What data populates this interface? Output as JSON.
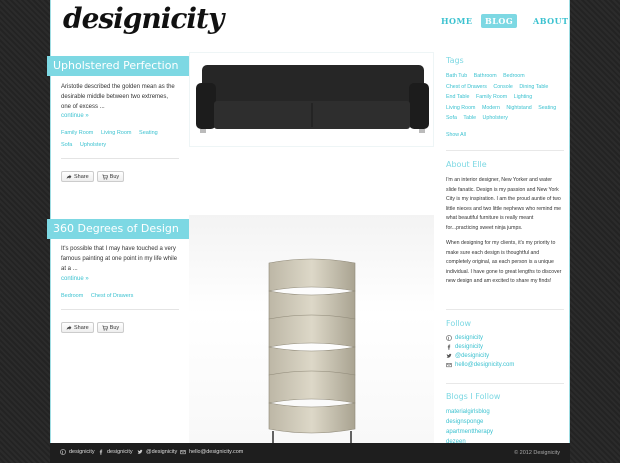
{
  "brand": {
    "logo": "designicity"
  },
  "nav": {
    "home": "HOME",
    "blog": "BLOG",
    "about": "ABOUT"
  },
  "posts": [
    {
      "title": "Upholstered Perfection",
      "excerpt": "Aristotle described the golden mean as the desirable middle between two extremes, one of excess ...",
      "continue": "continue »",
      "tags": [
        "Family Room",
        "Living Room",
        "Seating",
        "Sofa",
        "Upholstery"
      ],
      "share": "Share",
      "buy": "Buy"
    },
    {
      "title": "360 Degrees of Design",
      "excerpt": "It's possible that I may have touched a very famous painting at one point in my life while at a ...",
      "continue": "continue »",
      "tags": [
        "Bedroom",
        "Chest of Drawers"
      ],
      "share": "Share",
      "buy": "Buy"
    }
  ],
  "sidebar": {
    "tags_title": "Tags",
    "tags": [
      "Bath Tub",
      "Bathroom",
      "Bedroom",
      "Chest of Drawers",
      "Console",
      "Dining Table",
      "End Table",
      "Family Room",
      "Lighting",
      "Living Room",
      "Modern",
      "Nightstand",
      "Seating",
      "Sofa",
      "Table",
      "Upholstery"
    ],
    "show_all": "Show All",
    "about_title": "About Elle",
    "about_p1": "I'm an interior designer, New Yorker and water slide fanatic. Design is my passion and New York City is my inspiration. I am the proud auntie of two little nieces and two little nephews who remind me what beautiful furniture is really meant for...practicing sweet ninja jumps.",
    "about_p2": "When designing for my clients, it's my priority to make sure each design is thoughtful and completely original, as each person is a unique individual. I have gone to great lengths to discover new design and am excited to share my finds!",
    "follow_title": "Follow",
    "follow": {
      "pinterest": "designicity",
      "facebook": "designicity",
      "twitter": "@designicity",
      "email": "hello@designicity.com"
    },
    "blogs_title": "Blogs I Follow",
    "blogs": [
      "materialgirlsblog",
      "designsponge",
      "apartmenttherapy",
      "dezeen"
    ]
  },
  "footer": {
    "pinterest": "designicity",
    "facebook": "designicity",
    "twitter": "@designicity",
    "email": "hello@designicity.com",
    "copyright": "© 2012 Designicity"
  },
  "colors": {
    "accent": "#7dd8e3",
    "link": "#3cc2d0",
    "footer": "#1e1e1e"
  }
}
